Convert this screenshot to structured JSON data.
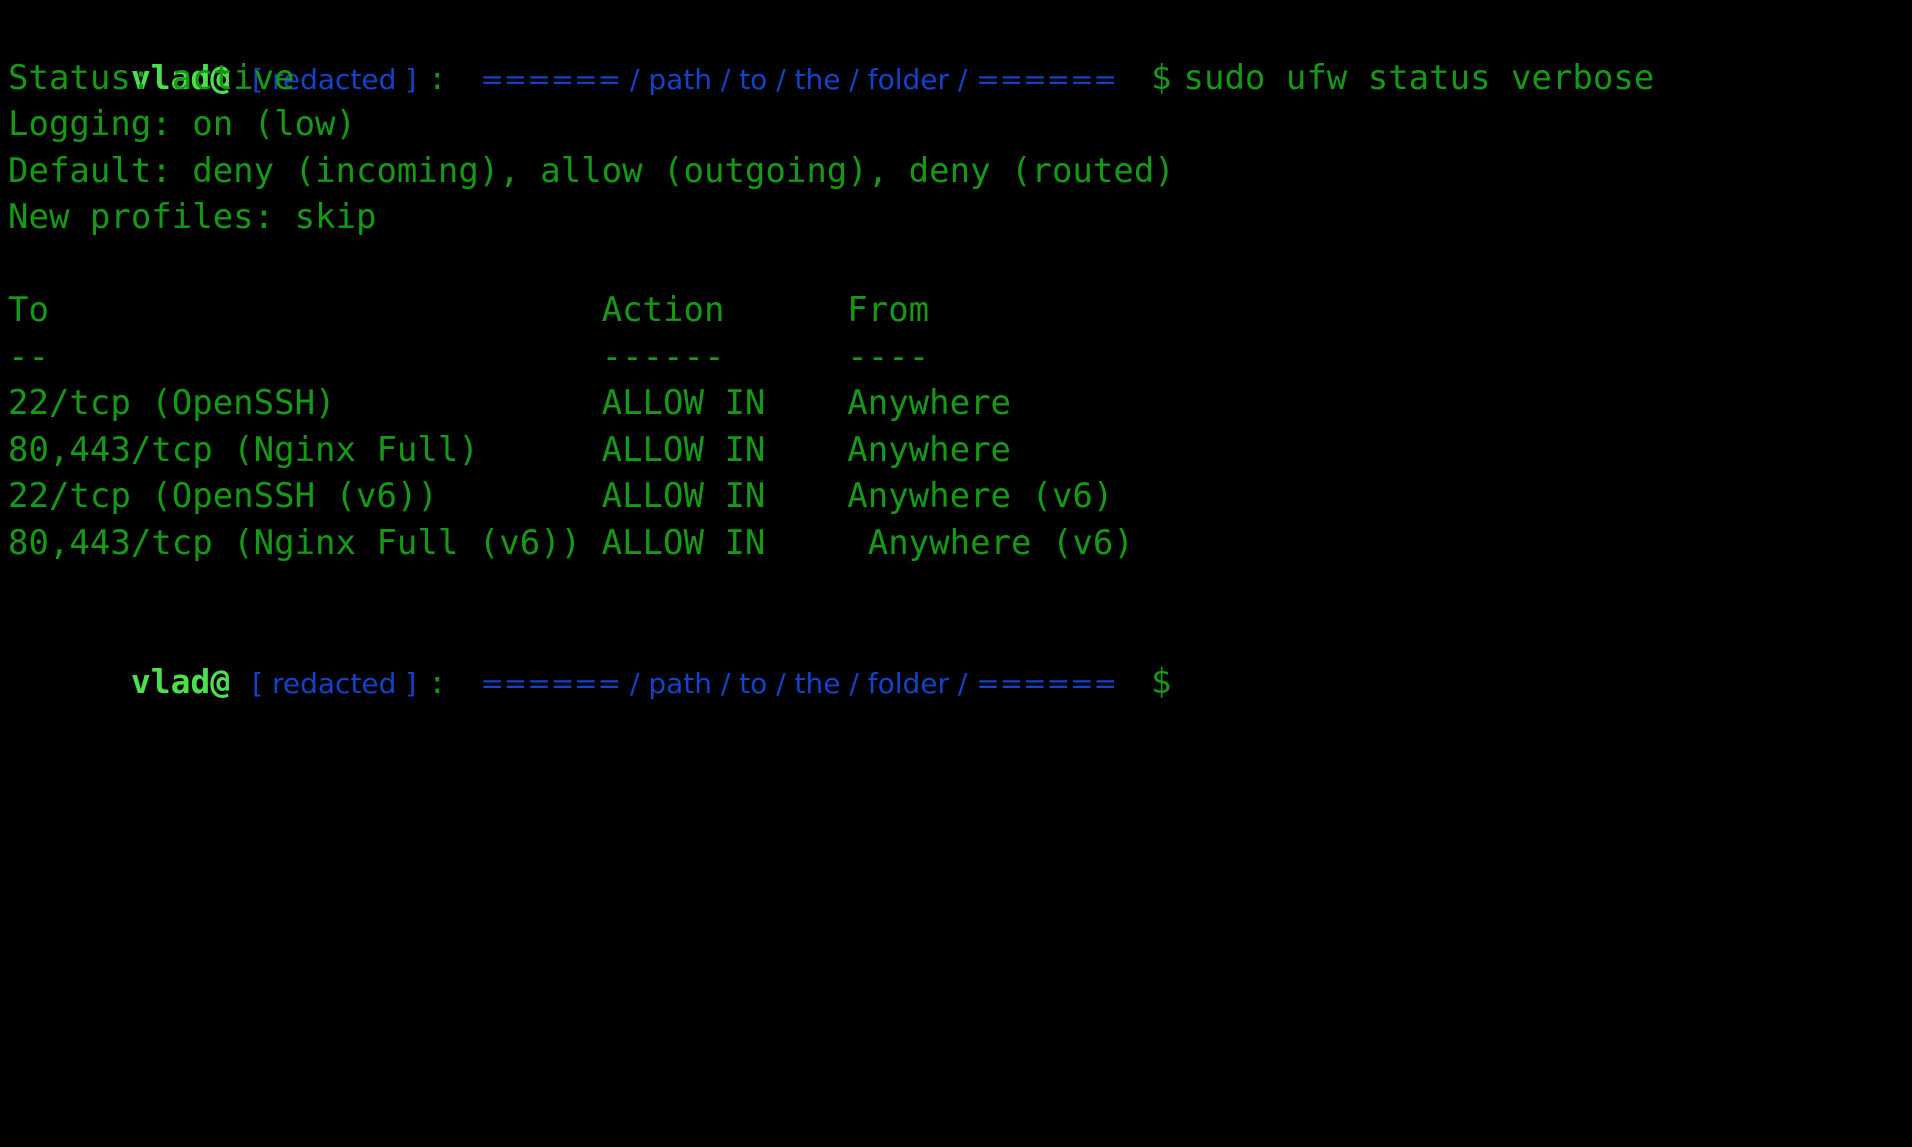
{
  "terminal": {
    "background_color": "#000000",
    "text_color": "#169916",
    "user_color": "#4ce04c",
    "path_color": "#1243c8"
  },
  "prompt": {
    "user": "vlad@",
    "host": "[ redacted ]",
    "separator": ":",
    "path": "====== / path / to / the / folder / ======",
    "symbol": "$"
  },
  "command": "sudo ufw status verbose",
  "output": {
    "status_line": "Status: active",
    "logging_line": "Logging: on (low)",
    "default_line": "Default: deny (incoming), allow (outgoing), deny (routed)",
    "new_profiles_line": "New profiles: skip",
    "blank": " ",
    "table": {
      "headers": [
        "To",
        "Action",
        "From"
      ],
      "header_line": "To                           Action      From",
      "divider_line": "--                           ------      ----",
      "rows": [
        {
          "to": "22/tcp (OpenSSH)",
          "action": "ALLOW IN",
          "from": "Anywhere",
          "raw": "22/tcp (OpenSSH)             ALLOW IN    Anywhere"
        },
        {
          "to": "80,443/tcp (Nginx Full)",
          "action": "ALLOW IN",
          "from": "Anywhere",
          "raw": "80,443/tcp (Nginx Full)      ALLOW IN    Anywhere"
        },
        {
          "to": "22/tcp (OpenSSH (v6))",
          "action": "ALLOW IN",
          "from": "Anywhere (v6)",
          "raw": "22/tcp (OpenSSH (v6))        ALLOW IN    Anywhere (v6)"
        },
        {
          "to": "80,443/tcp (Nginx Full (v6))",
          "action": "ALLOW IN",
          "from": "Anywhere (v6)",
          "raw": "80,443/tcp (Nginx Full (v6)) ALLOW IN     Anywhere (v6)"
        }
      ]
    }
  }
}
